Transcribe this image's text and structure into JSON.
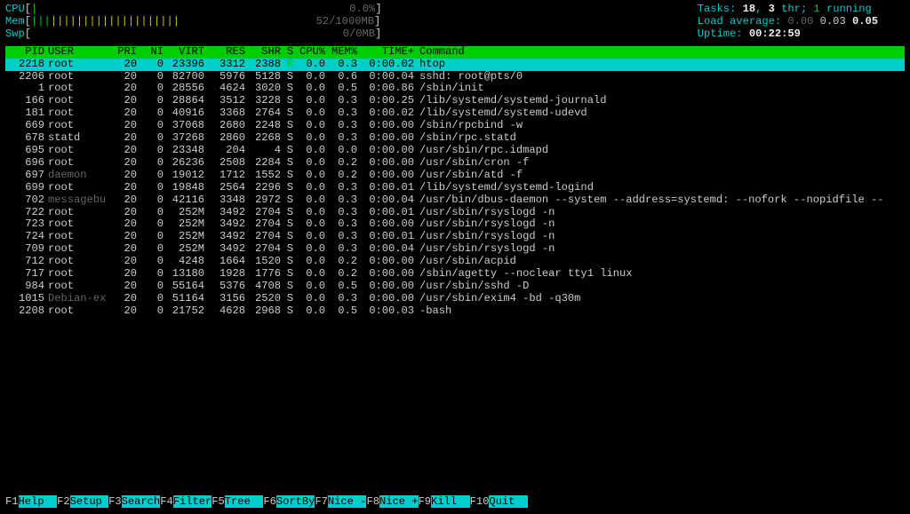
{
  "meters": {
    "cpu": {
      "label": "CPU",
      "bar": "|",
      "value": "0.0%"
    },
    "mem": {
      "label": "Mem",
      "bar": "|||||||||||||||||||||||",
      "value": "52/1000MB"
    },
    "swp": {
      "label": "Swp",
      "bar": "",
      "value": "0/0MB"
    }
  },
  "sysinfo": {
    "tasks_label": "Tasks: ",
    "tasks_nums": "18",
    "tasks_mid": ", ",
    "thr": "3",
    "thr_suffix": " thr; ",
    "running": "1",
    "running_suffix": " running",
    "load_label": "Load average: ",
    "load1": "0.00",
    "load5": "0.03",
    "load15": "0.05",
    "uptime_label": "Uptime: ",
    "uptime": "00:22:59"
  },
  "columns": [
    "PID",
    "USER",
    "PRI",
    "NI",
    "VIRT",
    "RES",
    "SHR",
    "S",
    "CPU%",
    "MEM%",
    "TIME+",
    "Command"
  ],
  "processes": [
    {
      "pid": "2218",
      "user": "root",
      "pri": "20",
      "ni": "0",
      "virt": "23396",
      "res": "3312",
      "shr": "2388",
      "s": "R",
      "cpu": "0.0",
      "mem": "0.3",
      "time": "0:00.02",
      "cmd": "htop",
      "hl": true
    },
    {
      "pid": "2206",
      "user": "root",
      "pri": "20",
      "ni": "0",
      "virt": "82700",
      "res": "5976",
      "shr": "5128",
      "s": "S",
      "cpu": "0.0",
      "mem": "0.6",
      "time": "0:00.04",
      "cmd": "sshd: root@pts/0"
    },
    {
      "pid": "1",
      "user": "root",
      "pri": "20",
      "ni": "0",
      "virt": "28556",
      "res": "4624",
      "shr": "3020",
      "s": "S",
      "cpu": "0.0",
      "mem": "0.5",
      "time": "0:00.86",
      "cmd": "/sbin/init"
    },
    {
      "pid": "166",
      "user": "root",
      "pri": "20",
      "ni": "0",
      "virt": "28864",
      "res": "3512",
      "shr": "3228",
      "s": "S",
      "cpu": "0.0",
      "mem": "0.3",
      "time": "0:00.25",
      "cmd": "/lib/systemd/systemd-journald"
    },
    {
      "pid": "181",
      "user": "root",
      "pri": "20",
      "ni": "0",
      "virt": "40916",
      "res": "3368",
      "shr": "2764",
      "s": "S",
      "cpu": "0.0",
      "mem": "0.3",
      "time": "0:00.02",
      "cmd": "/lib/systemd/systemd-udevd"
    },
    {
      "pid": "669",
      "user": "root",
      "pri": "20",
      "ni": "0",
      "virt": "37068",
      "res": "2680",
      "shr": "2248",
      "s": "S",
      "cpu": "0.0",
      "mem": "0.3",
      "time": "0:00.00",
      "cmd": "/sbin/rpcbind -w"
    },
    {
      "pid": "678",
      "user": "statd",
      "pri": "20",
      "ni": "0",
      "virt": "37268",
      "res": "2860",
      "shr": "2268",
      "s": "S",
      "cpu": "0.0",
      "mem": "0.3",
      "time": "0:00.00",
      "cmd": "/sbin/rpc.statd"
    },
    {
      "pid": "695",
      "user": "root",
      "pri": "20",
      "ni": "0",
      "virt": "23348",
      "res": "204",
      "shr": "4",
      "s": "S",
      "cpu": "0.0",
      "mem": "0.0",
      "time": "0:00.00",
      "cmd": "/usr/sbin/rpc.idmapd"
    },
    {
      "pid": "696",
      "user": "root",
      "pri": "20",
      "ni": "0",
      "virt": "26236",
      "res": "2508",
      "shr": "2284",
      "s": "S",
      "cpu": "0.0",
      "mem": "0.2",
      "time": "0:00.00",
      "cmd": "/usr/sbin/cron -f"
    },
    {
      "pid": "697",
      "user": "daemon",
      "dim": true,
      "pri": "20",
      "ni": "0",
      "virt": "19012",
      "res": "1712",
      "shr": "1552",
      "s": "S",
      "cpu": "0.0",
      "mem": "0.2",
      "time": "0:00.00",
      "cmd": "/usr/sbin/atd -f"
    },
    {
      "pid": "699",
      "user": "root",
      "pri": "20",
      "ni": "0",
      "virt": "19848",
      "res": "2564",
      "shr": "2296",
      "s": "S",
      "cpu": "0.0",
      "mem": "0.3",
      "time": "0:00.01",
      "cmd": "/lib/systemd/systemd-logind"
    },
    {
      "pid": "702",
      "user": "messagebu",
      "dim": true,
      "pri": "20",
      "ni": "0",
      "virt": "42116",
      "res": "3348",
      "shr": "2972",
      "s": "S",
      "cpu": "0.0",
      "mem": "0.3",
      "time": "0:00.04",
      "cmd": "/usr/bin/dbus-daemon --system --address=systemd: --nofork --nopidfile --"
    },
    {
      "pid": "722",
      "user": "root",
      "pri": "20",
      "ni": "0",
      "virt": "252M",
      "res": "3492",
      "shr": "2704",
      "s": "S",
      "cpu": "0.0",
      "mem": "0.3",
      "time": "0:00.01",
      "cmd": "/usr/sbin/rsyslogd -n"
    },
    {
      "pid": "723",
      "user": "root",
      "pri": "20",
      "ni": "0",
      "virt": "252M",
      "res": "3492",
      "shr": "2704",
      "s": "S",
      "cpu": "0.0",
      "mem": "0.3",
      "time": "0:00.00",
      "cmd": "/usr/sbin/rsyslogd -n"
    },
    {
      "pid": "724",
      "user": "root",
      "pri": "20",
      "ni": "0",
      "virt": "252M",
      "res": "3492",
      "shr": "2704",
      "s": "S",
      "cpu": "0.0",
      "mem": "0.3",
      "time": "0:00.01",
      "cmd": "/usr/sbin/rsyslogd -n"
    },
    {
      "pid": "709",
      "user": "root",
      "pri": "20",
      "ni": "0",
      "virt": "252M",
      "res": "3492",
      "shr": "2704",
      "s": "S",
      "cpu": "0.0",
      "mem": "0.3",
      "time": "0:00.04",
      "cmd": "/usr/sbin/rsyslogd -n"
    },
    {
      "pid": "712",
      "user": "root",
      "pri": "20",
      "ni": "0",
      "virt": "4248",
      "res": "1664",
      "shr": "1520",
      "s": "S",
      "cpu": "0.0",
      "mem": "0.2",
      "time": "0:00.00",
      "cmd": "/usr/sbin/acpid"
    },
    {
      "pid": "717",
      "user": "root",
      "pri": "20",
      "ni": "0",
      "virt": "13180",
      "res": "1928",
      "shr": "1776",
      "s": "S",
      "cpu": "0.0",
      "mem": "0.2",
      "time": "0:00.00",
      "cmd": "/sbin/agetty --noclear tty1 linux"
    },
    {
      "pid": "984",
      "user": "root",
      "pri": "20",
      "ni": "0",
      "virt": "55164",
      "res": "5376",
      "shr": "4708",
      "s": "S",
      "cpu": "0.0",
      "mem": "0.5",
      "time": "0:00.00",
      "cmd": "/usr/sbin/sshd -D"
    },
    {
      "pid": "1015",
      "user": "Debian-ex",
      "dim": true,
      "pri": "20",
      "ni": "0",
      "virt": "51164",
      "res": "3156",
      "shr": "2520",
      "s": "S",
      "cpu": "0.0",
      "mem": "0.3",
      "time": "0:00.00",
      "cmd": "/usr/sbin/exim4 -bd -q30m"
    },
    {
      "pid": "2208",
      "user": "root",
      "pri": "20",
      "ni": "0",
      "virt": "21752",
      "res": "4628",
      "shr": "2968",
      "s": "S",
      "cpu": "0.0",
      "mem": "0.5",
      "time": "0:00.03",
      "cmd": "-bash"
    }
  ],
  "footer": [
    {
      "key": "F1",
      "label": "Help  "
    },
    {
      "key": "F2",
      "label": "Setup "
    },
    {
      "key": "F3",
      "label": "Search"
    },
    {
      "key": "F4",
      "label": "Filter"
    },
    {
      "key": "F5",
      "label": "Tree  "
    },
    {
      "key": "F6",
      "label": "SortBy"
    },
    {
      "key": "F7",
      "label": "Nice -"
    },
    {
      "key": "F8",
      "label": "Nice +"
    },
    {
      "key": "F9",
      "label": "Kill  "
    },
    {
      "key": "F10",
      "label": "Quit  "
    }
  ]
}
